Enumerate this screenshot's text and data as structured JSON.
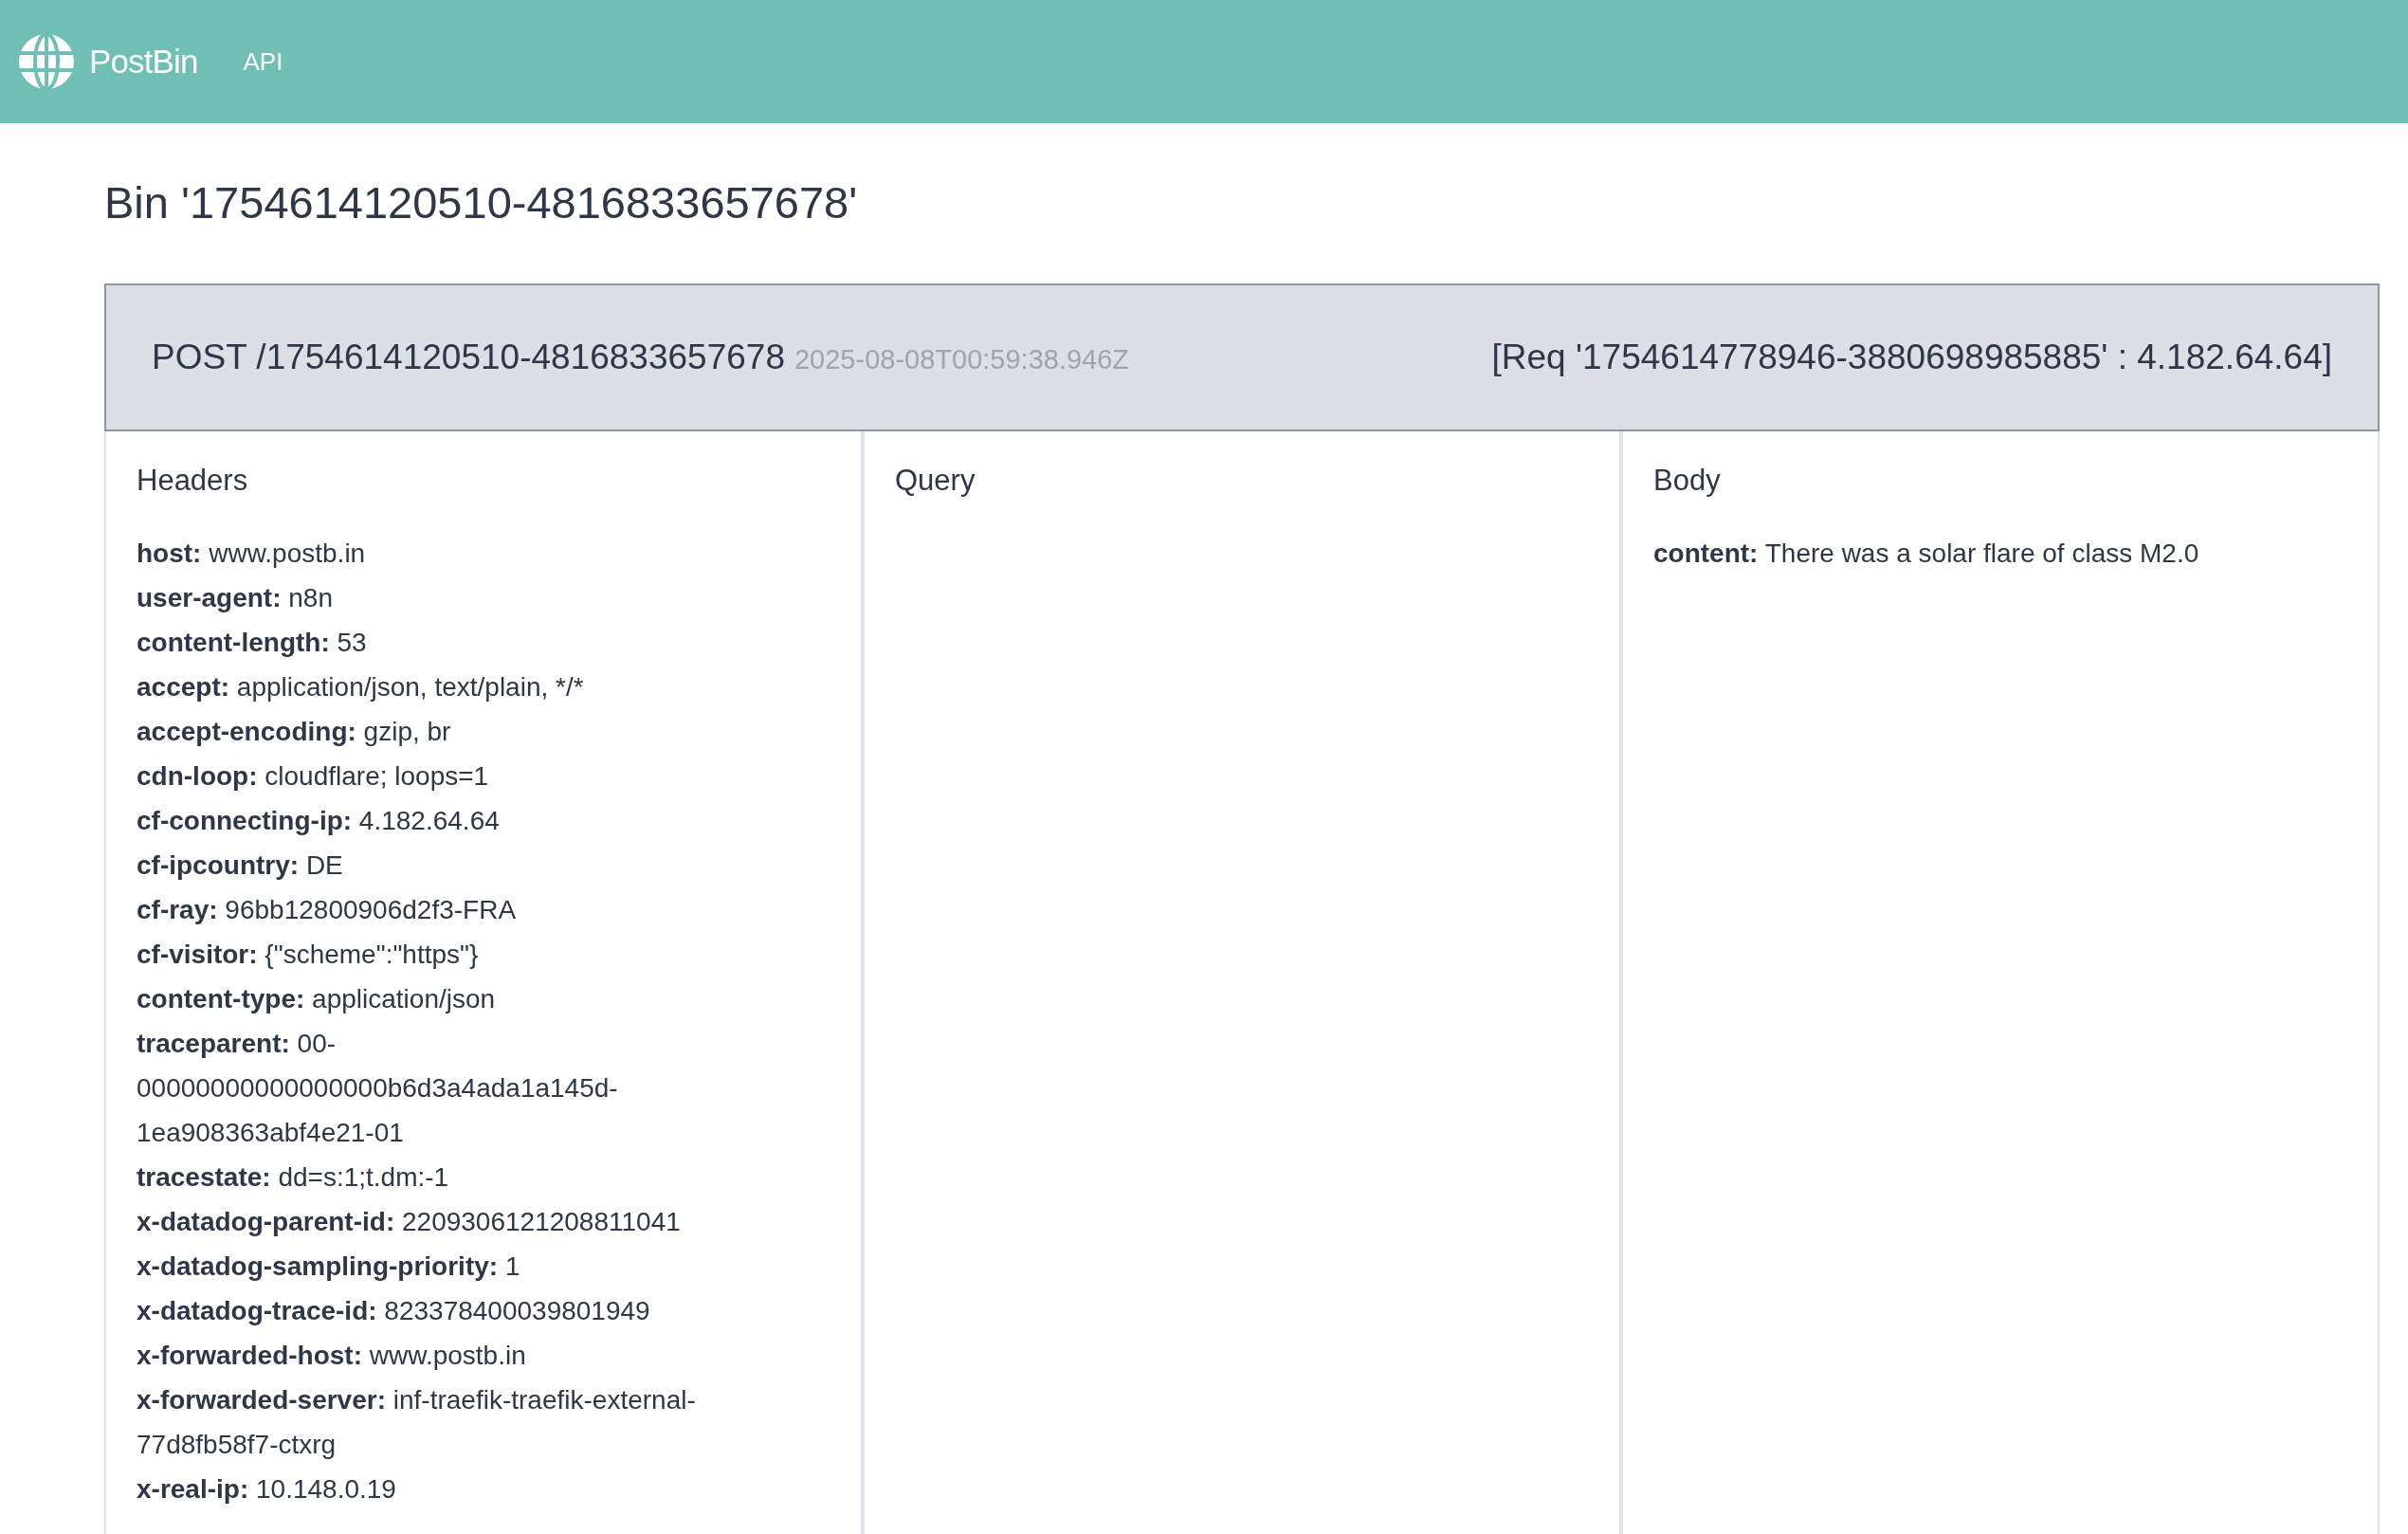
{
  "navbar": {
    "brand": "PostBin",
    "links": [
      {
        "label": "API"
      }
    ]
  },
  "title": "Bin '1754614120510-4816833657678'",
  "request": {
    "line": "POST /1754614120510-4816833657678",
    "timestamp": "2025-08-08T00:59:38.946Z",
    "summary": "[Req '1754614778946-3880698985885' : 4.182.64.64]"
  },
  "panels": [
    {
      "title": "Headers",
      "entries": [
        {
          "key": "host:",
          "value": "www.postb.in"
        },
        {
          "key": "user-agent:",
          "value": "n8n"
        },
        {
          "key": "content-length:",
          "value": "53"
        },
        {
          "key": "accept:",
          "value": "application/json, text/plain, */*"
        },
        {
          "key": "accept-encoding:",
          "value": "gzip, br"
        },
        {
          "key": "cdn-loop:",
          "value": "cloudflare; loops=1"
        },
        {
          "key": "cf-connecting-ip:",
          "value": "4.182.64.64"
        },
        {
          "key": "cf-ipcountry:",
          "value": "DE"
        },
        {
          "key": "cf-ray:",
          "value": "96bb12800906d2f3-FRA"
        },
        {
          "key": "cf-visitor:",
          "value": "{\"scheme\":\"https\"}"
        },
        {
          "key": "content-type:",
          "value": "application/json"
        },
        {
          "key": "traceparent:",
          "value": "00-00000000000000000b6d3a4ada1a145d-1ea908363abf4e21-01"
        },
        {
          "key": "tracestate:",
          "value": "dd=s:1;t.dm:-1"
        },
        {
          "key": "x-datadog-parent-id:",
          "value": "2209306121208811041"
        },
        {
          "key": "x-datadog-sampling-priority:",
          "value": "1"
        },
        {
          "key": "x-datadog-trace-id:",
          "value": "823378400039801949"
        },
        {
          "key": "x-forwarded-host:",
          "value": "www.postb.in"
        },
        {
          "key": "x-forwarded-server:",
          "value": "inf-traefik-traefik-external-77d8fb58f7-ctxrg"
        },
        {
          "key": "x-real-ip:",
          "value": "10.148.0.19"
        }
      ]
    },
    {
      "title": "Query"
    },
    {
      "title": "Body",
      "entries": [
        {
          "key": "content:",
          "value": "There was a solar flare of class M2.0"
        }
      ]
    }
  ]
}
